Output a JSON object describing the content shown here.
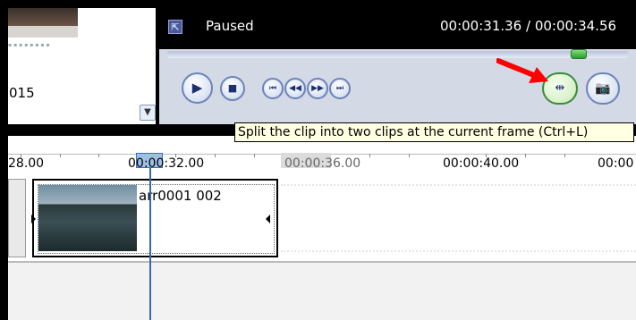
{
  "clip_list": {
    "clip_name": "015"
  },
  "player": {
    "status_icon": "restore-icon",
    "status": "Paused",
    "time": "00:00:31.36 / 00:00:34.56",
    "controls": {
      "play": "▶",
      "stop": "■",
      "prev_frame": "⏮",
      "rewind": "◀◀",
      "forward": "▶▶",
      "next_frame": "⏭",
      "split": "⇹",
      "snapshot": "📷"
    }
  },
  "tooltip": {
    "text": "Split the clip into two clips at the current frame (Ctrl+L)"
  },
  "ruler": {
    "labels": [
      "28.00",
      "00:00:32.00",
      "00:00:36.00",
      "00:00:40.00",
      "00:00"
    ]
  },
  "timeline": {
    "clip_label": "arr0001 002"
  },
  "colors": {
    "playhead": "#2f6ab3",
    "annotation_arrow": "#ff0000",
    "tooltip_bg": "#ffffe1"
  }
}
